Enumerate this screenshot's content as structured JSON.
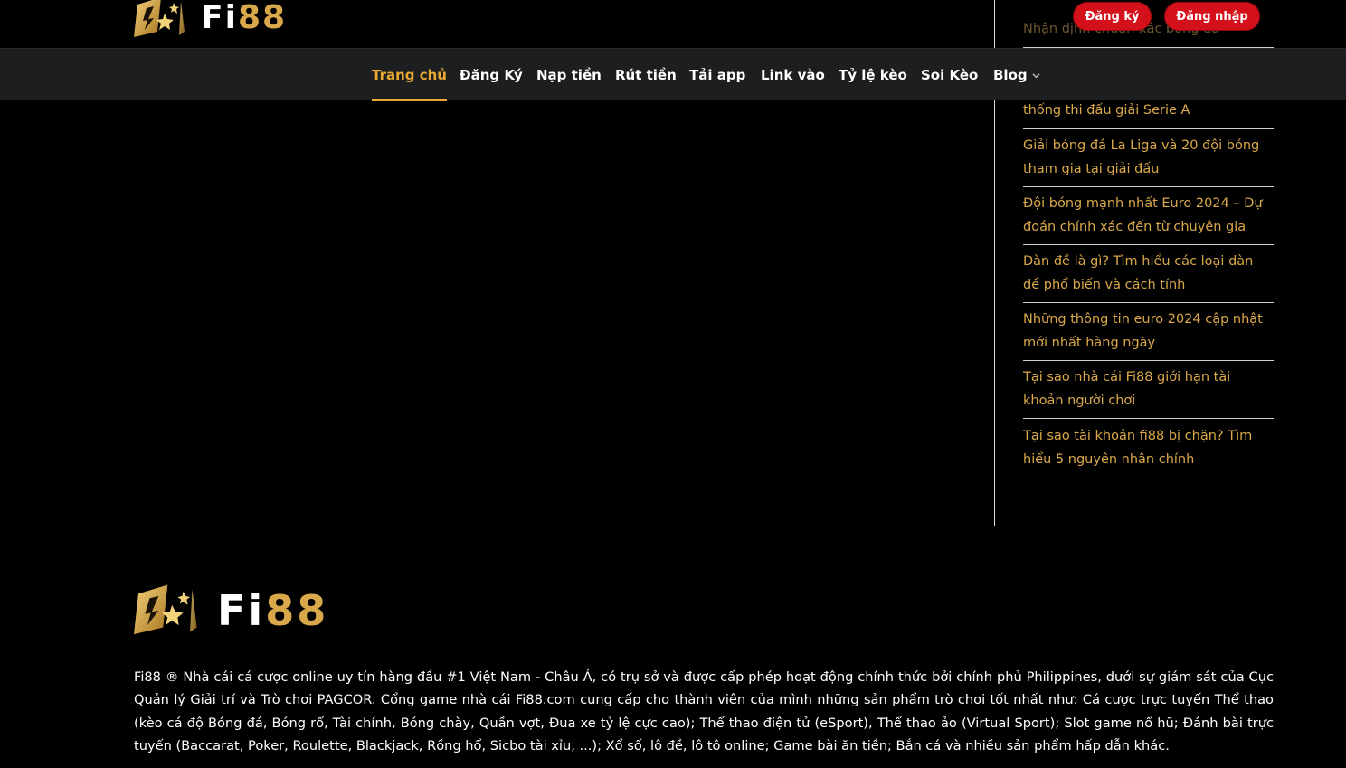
{
  "brand": {
    "fi": "Fi",
    "num": "88"
  },
  "header": {
    "register_label": "Đăng ký",
    "login_label": "Đăng nhập"
  },
  "nav": {
    "items": [
      {
        "label": "Trang chủ"
      },
      {
        "label": "Đăng Ký"
      },
      {
        "label": "Nạp tiền"
      },
      {
        "label": "Rút tiền"
      },
      {
        "label": "Tải app"
      },
      {
        "label": "Link vào"
      },
      {
        "label": "Tỷ lệ kèo"
      },
      {
        "label": "Soi Kèo"
      },
      {
        "label": "Blog"
      }
    ]
  },
  "sidebar": {
    "posts": [
      {
        "title": "Nhận định chuẩn xác bóng đá"
      },
      {
        "title": "thống thi đấu giải Serie A"
      },
      {
        "title": "Giải bóng đá La Liga và 20 đội bóng tham gia tại giải đấu"
      },
      {
        "title": "Đội bóng mạnh nhất Euro 2024 – Dự đoán chính xác đến từ chuyên gia"
      },
      {
        "title": "Dàn đề là gì? Tìm hiểu các loại dàn đề phổ biến và cách tính"
      },
      {
        "title": "Những thông tin euro 2024 cập nhật mới nhất hàng ngày"
      },
      {
        "title": "Tại sao nhà cái Fi88 giới hạn tài khoản người chơi"
      },
      {
        "title": "Tại sao tài khoản fi88 bị chặn? Tìm hiểu 5 nguyên nhân chính"
      }
    ]
  },
  "footer": {
    "description": "Fi88 ® Nhà cái cá cược online uy tín hàng đầu #1 Việt Nam - Châu Á, có trụ sở và được cấp phép hoạt động chính thức bởi chính phủ Philippines, dưới sự giám sát của Cục Quản lý Giải trí và Trò chơi PAGCOR. Cổng game nhà cái Fi88.com cung cấp cho thành viên của mình những sản phẩm trò chơi tốt nhất như: Cá cược trực tuyến Thể thao (kèo cá độ Bóng đá, Bóng rổ, Tài chính, Bóng chày, Quần vợt, Đua xe tỷ lệ cực cao); Thể thao điện tử (eSport), Thể thao ảo (Virtual Sport); Slot game nổ hũ; Đánh bài trực tuyến (Baccarat, Poker, Roulette, Blackjack, Rồng hổ, Sicbo tài xỉu, ...); Xổ số, lô đề, lô tô online; Game bài ăn tiền; Bắn cá và nhiều sản phẩm hấp dẫn khác."
  },
  "colors": {
    "accent_gold": "#d9a84a",
    "nav_active": "#e8a832",
    "button_red": "#d4111a",
    "nav_bg": "#1d1e20"
  },
  "icons": {
    "logo": "fi88-logo-icon",
    "dropdown": "chevron-down-icon"
  }
}
